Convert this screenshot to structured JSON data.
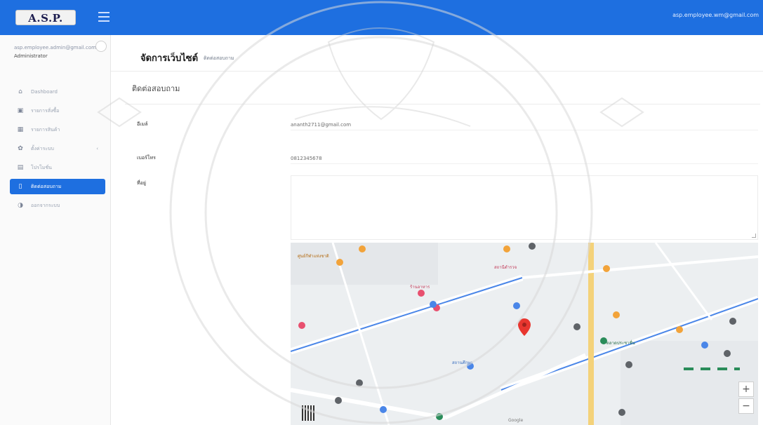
{
  "header": {
    "logo_text": "A.S.P.",
    "user_email": "asp.employee.wm@gmail.com"
  },
  "sidebar": {
    "user_email": "asp.employee.admin@gmail.com",
    "user_role": "Administrator",
    "items": [
      {
        "label": "Dashboard",
        "icon": "home-icon"
      },
      {
        "label": "รายการสั่งซื้อ",
        "icon": "cart-icon"
      },
      {
        "label": "รายการสินค้า",
        "icon": "table-icon"
      },
      {
        "label": "ตั้งค่าระบบ",
        "icon": "gear-icon"
      },
      {
        "label": "โปรโมชั่น",
        "icon": "tag-icon"
      },
      {
        "label": "ติดต่อสอบถาม",
        "icon": "phone-icon"
      },
      {
        "label": "ออกจากระบบ",
        "icon": "power-icon"
      }
    ],
    "active_index": 5
  },
  "page": {
    "title": "จัดการเว็บไซต์",
    "breadcrumb": "ติดต่อสอบถาม",
    "section_title": "ติดต่อสอบถาม"
  },
  "form": {
    "email_label": "อีเมล์",
    "email_value": "ananth2711@gmail.com",
    "phone_label": "เบอร์โทร",
    "phone_value": "0812345678",
    "address_label": "ที่อยู่"
  },
  "map": {
    "labels": [
      "ศูนย์กีฬาแห่งชาติ",
      "สถานีตำรวจ",
      "ร้านอาหาร",
      "ตลาดประชาชื่น",
      "สถานศึกษา",
      "Google"
    ],
    "zoom_in": "+",
    "zoom_out": "−"
  },
  "colors": {
    "primary": "#1e6fe0",
    "sidebar_bg": "#fafafa",
    "map_marker": "#e8362f"
  }
}
